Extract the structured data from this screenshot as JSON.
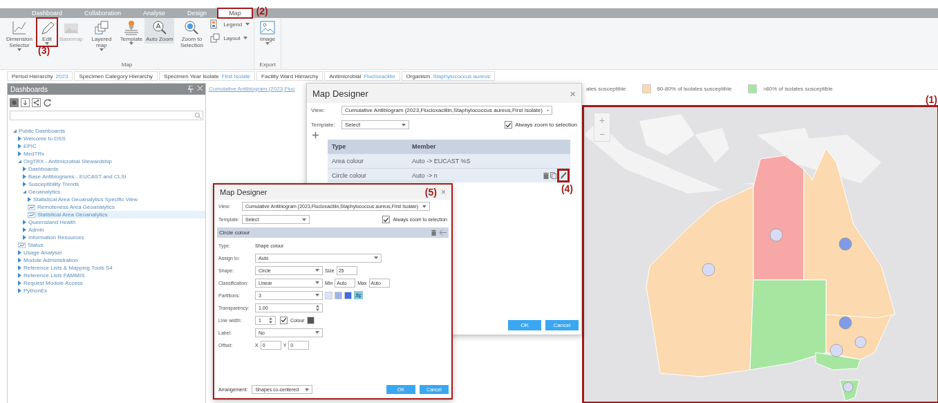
{
  "tabs": [
    {
      "label": "Dashboard",
      "selected": false
    },
    {
      "label": "Collaboration",
      "selected": false
    },
    {
      "label": "Analyse",
      "selected": false
    },
    {
      "label": "Design",
      "selected": false
    },
    {
      "label": "Map",
      "selected": true,
      "annotation": "(2)"
    }
  ],
  "ribbon": {
    "groups": [
      {
        "label": "Map",
        "buttons": [
          {
            "kind": "large",
            "label": "Dimension Selector",
            "dropdown": true,
            "disabled": false,
            "selected": false
          },
          {
            "kind": "large",
            "label": "Edit",
            "dropdown": true,
            "disabled": false,
            "selected": false,
            "annotation": "(3)"
          },
          {
            "kind": "large",
            "label": "Basemap",
            "dropdown": false,
            "disabled": true,
            "selected": false
          },
          {
            "kind": "large",
            "label": "Layered map",
            "dropdown": true,
            "disabled": false,
            "selected": false
          },
          {
            "kind": "large",
            "label": "Template",
            "dropdown": true,
            "disabled": false,
            "selected": false
          },
          {
            "kind": "large",
            "label": "Auto Zoom",
            "dropdown": false,
            "disabled": false,
            "selected": true
          },
          {
            "kind": "large",
            "label": "Zoom to Selection",
            "dropdown": false,
            "disabled": false,
            "selected": false
          },
          {
            "kind": "small",
            "label": "Legend",
            "dropdown": true,
            "disabled": false,
            "selected": false
          },
          {
            "kind": "small",
            "label": "Layout",
            "dropdown": true,
            "disabled": false,
            "selected": false
          }
        ]
      },
      {
        "label": "Export",
        "buttons": [
          {
            "kind": "large",
            "label": "Image",
            "dropdown": true,
            "disabled": false,
            "selected": false
          }
        ]
      }
    ]
  },
  "filters": [
    {
      "label": "Period Hierarchy",
      "value": "2023"
    },
    {
      "label": "Specimen Category Hierarchy"
    },
    {
      "label": "Specimen Year Isolate",
      "value": "First Isolate"
    },
    {
      "label": "Facility Ward Hierarchy"
    },
    {
      "label": "Antimicrobial",
      "value": "Flucloxacillin"
    },
    {
      "label": "Organism",
      "value": "Staphylococcus aureus"
    }
  ],
  "sidebar": {
    "title": "Dashboards",
    "tree": [
      {
        "label": "Public Dashboards",
        "kind": "folder",
        "expanded": true,
        "selected": false,
        "children": [
          {
            "label": "Welcome to DSS",
            "kind": "folder",
            "expanded": false,
            "selected": false
          },
          {
            "label": "EPIC",
            "kind": "folder",
            "expanded": false,
            "selected": false
          },
          {
            "label": "MedTRx",
            "kind": "folder",
            "expanded": false,
            "selected": false
          },
          {
            "label": "OrgTRX - Antimicrobial Stewardship",
            "kind": "folder",
            "expanded": true,
            "selected": false,
            "children": [
              {
                "label": "Dashboards",
                "kind": "folder",
                "expanded": false,
                "selected": false
              },
              {
                "label": "Base Antibiograms - EUCAST and CLSI",
                "kind": "folder",
                "expanded": false,
                "selected": false
              },
              {
                "label": "Susceptibility Trends",
                "kind": "folder",
                "expanded": false,
                "selected": false
              },
              {
                "label": "Geoanalytics",
                "kind": "folder",
                "expanded": true,
                "selected": false,
                "children": [
                  {
                    "label": "Statistical Area Geoanalytics Specific View",
                    "kind": "folder",
                    "expanded": false,
                    "selected": false
                  },
                  {
                    "label": "Remoteness Area Geoanalytics",
                    "kind": "dashboard",
                    "selected": false
                  },
                  {
                    "label": "Statistical Area Geoanalytics",
                    "kind": "dashboard",
                    "selected": true
                  }
                ]
              },
              {
                "label": "Queensland Health",
                "kind": "folder",
                "expanded": false,
                "selected": false
              },
              {
                "label": "Admin",
                "kind": "folder",
                "expanded": false,
                "selected": false
              },
              {
                "label": "Information Resources",
                "kind": "folder",
                "expanded": false,
                "selected": false
              }
            ]
          },
          {
            "label": "Status",
            "kind": "dashboard",
            "selected": false
          },
          {
            "label": "Usage Analyser",
            "kind": "folder",
            "expanded": false,
            "selected": false
          },
          {
            "label": "Module Administration",
            "kind": "folder",
            "expanded": false,
            "selected": false
          },
          {
            "label": "Reference Lists & Mapping Tools S4",
            "kind": "folder",
            "expanded": false,
            "selected": false
          },
          {
            "label": "Reference Lists FAMMIS",
            "kind": "folder",
            "expanded": false,
            "selected": false
          },
          {
            "label": "Request Module Access",
            "kind": "folder",
            "expanded": false,
            "selected": false
          },
          {
            "label": "PythonEx",
            "kind": "folder",
            "expanded": false,
            "selected": false
          }
        ]
      }
    ]
  },
  "content": {
    "view_link": "Cumulative Antibiogram (2023,Fluc",
    "legend": [
      {
        "label": "ates susceptible"
      },
      {
        "label": "60-80% of isolates susceptible",
        "color": "#fcd9ae"
      },
      {
        "label": ">80% of isolates susceptible",
        "color": "#a6e6a0"
      }
    ],
    "map": {
      "kind": "picture",
      "annotation": "(1)",
      "zoom_controls": [
        "+",
        "−"
      ]
    }
  },
  "designer": {
    "title": "Map Designer",
    "close": "×",
    "view_label": "View:",
    "view": "Cumulative Antibiogram (2023,Flucloxacillin,Staphylococcus aureus,First Isolate)",
    "template_label": "Template:",
    "template": "Select",
    "zoom_checkbox": {
      "label": "Always zoom to selection",
      "checked": true
    },
    "table": {
      "columns": [
        "Type",
        "Member"
      ],
      "rows": [
        {
          "cells": [
            "Area colour",
            "Auto -> EUCAST %S"
          ],
          "actions": false
        },
        {
          "cells": [
            "Circle colour",
            "Auto -> n"
          ],
          "actions": true,
          "annotation": "(4)"
        }
      ]
    },
    "buttons": [
      "OK",
      "Cancel"
    ]
  },
  "editor": {
    "title": "Map Designer",
    "annotation": "(5)",
    "close": "×",
    "view_label": "View:",
    "view": "Cumulative Antibiogram (2023,Flucloxacillin,Staphylococcus aureus,First Isolate)",
    "template_label": "Template:",
    "template": "Select",
    "zoom_checkbox": {
      "label": "Always zoom to selection",
      "checked": true
    },
    "section": "Circle colour",
    "rows": [
      {
        "label": "Type:",
        "controls": [
          {
            "kind": "text",
            "text": "Shape colour"
          }
        ]
      },
      {
        "label": "Assign to:",
        "controls": [
          {
            "kind": "wide_select",
            "value": "Auto"
          }
        ]
      },
      {
        "label": "Shape:",
        "controls": [
          {
            "kind": "select",
            "value": "Circle"
          },
          {
            "kind": "label",
            "text": "Size"
          },
          {
            "kind": "field",
            "value": "25"
          }
        ]
      },
      {
        "label": "Classification:",
        "controls": [
          {
            "kind": "select",
            "value": "Linear"
          },
          {
            "kind": "label",
            "text": "Min"
          },
          {
            "kind": "field",
            "value": "Auto"
          },
          {
            "kind": "label",
            "text": "Max"
          },
          {
            "kind": "field",
            "value": "Auto"
          }
        ]
      },
      {
        "label": "Partitions:",
        "controls": [
          {
            "kind": "select",
            "value": "3"
          },
          {
            "kind": "swatch",
            "color": "#dde2fb"
          },
          {
            "kind": "swatch",
            "color": "#9db2f1"
          },
          {
            "kind": "swatch",
            "color": "#3d6ce6"
          },
          {
            "kind": "reverse"
          }
        ]
      },
      {
        "label": "Transparency:",
        "controls": [
          {
            "kind": "spinner",
            "value": "1.00"
          }
        ]
      },
      {
        "label": "Line width:",
        "controls": [
          {
            "kind": "small_spinner",
            "value": "1"
          },
          {
            "kind": "checkbox",
            "label": "Colour",
            "checked": true
          },
          {
            "kind": "swatch",
            "color": "#555555"
          }
        ]
      },
      {
        "label": "Label:",
        "controls": [
          {
            "kind": "select",
            "value": "No"
          }
        ]
      },
      {
        "label": "Offset:",
        "controls": [
          {
            "kind": "label",
            "text": "X"
          },
          {
            "kind": "field",
            "value": "0"
          },
          {
            "kind": "label",
            "text": "Y"
          },
          {
            "kind": "field",
            "value": "0"
          }
        ]
      }
    ],
    "arrangement_label": "Arrangement:",
    "arrangement": "Shapes co-centered",
    "buttons": [
      "OK",
      "Cancel"
    ]
  }
}
